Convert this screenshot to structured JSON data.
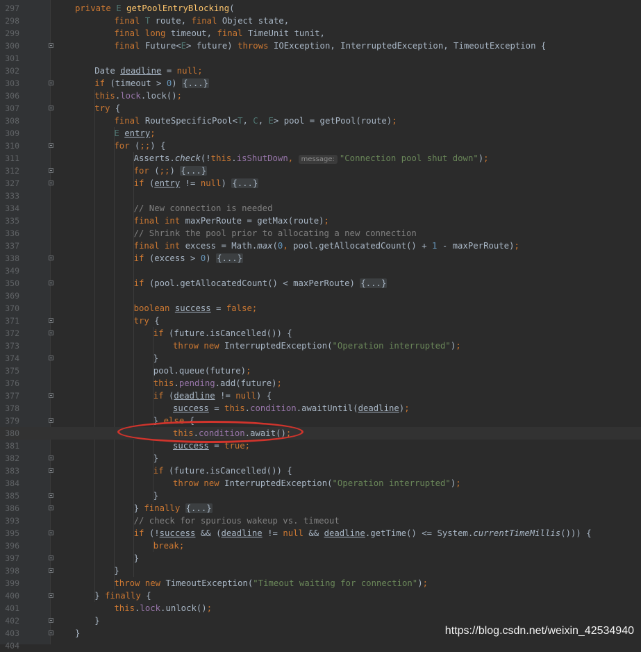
{
  "editor": {
    "lines": [
      {
        "n": "297",
        "indent": 0,
        "fold": false,
        "t": [
          [
            "kw",
            "private "
          ],
          [
            "tp",
            "E "
          ],
          [
            "fn",
            "getPoolEntryBlocking"
          ],
          [
            "",
            "("
          ]
        ]
      },
      {
        "n": "298",
        "indent": 2,
        "fold": false,
        "t": [
          [
            "kw",
            "final "
          ],
          [
            "tp",
            "T "
          ],
          [
            "",
            "route, "
          ],
          [
            "kw",
            "final "
          ],
          [
            "",
            "Object state,"
          ]
        ]
      },
      {
        "n": "299",
        "indent": 2,
        "fold": false,
        "t": [
          [
            "kw",
            "final long "
          ],
          [
            "",
            "timeout, "
          ],
          [
            "kw",
            "final "
          ],
          [
            "",
            "TimeUnit tunit,"
          ]
        ]
      },
      {
        "n": "300",
        "indent": 2,
        "fold": true,
        "t": [
          [
            "kw",
            "final "
          ],
          [
            "",
            "Future<"
          ],
          [
            "tp",
            "E"
          ],
          [
            "",
            "> future) "
          ],
          [
            "kw",
            "throws "
          ],
          [
            "",
            "IOException, InterruptedException, TimeoutException {"
          ]
        ]
      },
      {
        "n": "301",
        "indent": 0,
        "fold": false,
        "t": []
      },
      {
        "n": "302",
        "indent": 1,
        "fold": false,
        "t": [
          [
            "",
            "Date "
          ],
          [
            "ul",
            "deadline"
          ],
          [
            "",
            " = "
          ],
          [
            "kw",
            "null"
          ],
          [
            "kw",
            ";"
          ]
        ]
      },
      {
        "n": "303",
        "indent": 1,
        "fold": true,
        "t": [
          [
            "kw",
            "if "
          ],
          [
            "",
            "(timeout > "
          ],
          [
            "num",
            "0"
          ],
          [
            "",
            ") "
          ],
          [
            "ph",
            "{...}"
          ]
        ]
      },
      {
        "n": "306",
        "indent": 1,
        "fold": false,
        "t": [
          [
            "kw",
            "this"
          ],
          [
            "",
            "."
          ],
          [
            "fld",
            "lock"
          ],
          [
            "",
            ".lock()"
          ],
          [
            "kw",
            ";"
          ]
        ]
      },
      {
        "n": "307",
        "indent": 1,
        "fold": true,
        "t": [
          [
            "kw",
            "try "
          ],
          [
            "",
            "{"
          ]
        ]
      },
      {
        "n": "308",
        "indent": 2,
        "fold": false,
        "t": [
          [
            "kw",
            "final "
          ],
          [
            "",
            "RouteSpecificPool<"
          ],
          [
            "tp",
            "T"
          ],
          [
            "",
            ", "
          ],
          [
            "tp",
            "C"
          ],
          [
            "",
            ", "
          ],
          [
            "tp",
            "E"
          ],
          [
            "",
            "> pool = getPool(route)"
          ],
          [
            "kw",
            ";"
          ]
        ]
      },
      {
        "n": "309",
        "indent": 2,
        "fold": false,
        "t": [
          [
            "tp",
            "E "
          ],
          [
            "ul",
            "entry"
          ],
          [
            "kw",
            ";"
          ]
        ]
      },
      {
        "n": "310",
        "indent": 2,
        "fold": true,
        "t": [
          [
            "kw",
            "for "
          ],
          [
            "",
            "("
          ],
          [
            "kw",
            ";;"
          ],
          [
            "",
            ") {"
          ]
        ]
      },
      {
        "n": "311",
        "indent": 3,
        "fold": false,
        "t": [
          [
            "",
            "Asserts."
          ],
          [
            "st",
            "check"
          ],
          [
            "",
            "(!"
          ],
          [
            "kw",
            "this"
          ],
          [
            "",
            "."
          ],
          [
            "fld",
            "isShutDown"
          ],
          [
            "kw",
            ", "
          ],
          [
            "hint",
            "message:"
          ],
          [
            "str",
            "\"Connection pool shut down\""
          ],
          [
            "",
            ")"
          ],
          [
            "kw",
            ";"
          ]
        ]
      },
      {
        "n": "312",
        "indent": 3,
        "fold": true,
        "t": [
          [
            "kw",
            "for "
          ],
          [
            "",
            "("
          ],
          [
            "kw",
            ";;"
          ],
          [
            "",
            ") "
          ],
          [
            "ph",
            "{...}"
          ]
        ]
      },
      {
        "n": "327",
        "indent": 3,
        "fold": true,
        "t": [
          [
            "kw",
            "if "
          ],
          [
            "",
            "("
          ],
          [
            "ul",
            "entry"
          ],
          [
            "",
            " != "
          ],
          [
            "kw",
            "null"
          ],
          [
            "",
            ") "
          ],
          [
            "ph",
            "{...}"
          ]
        ]
      },
      {
        "n": "333",
        "indent": 0,
        "fold": false,
        "t": []
      },
      {
        "n": "334",
        "indent": 3,
        "fold": false,
        "t": [
          [
            "cm",
            "// New connection is needed"
          ]
        ]
      },
      {
        "n": "335",
        "indent": 3,
        "fold": false,
        "t": [
          [
            "kw",
            "final int "
          ],
          [
            "",
            "maxPerRoute = getMax(route)"
          ],
          [
            "kw",
            ";"
          ]
        ]
      },
      {
        "n": "336",
        "indent": 3,
        "fold": false,
        "t": [
          [
            "cm",
            "// Shrink the pool prior to allocating a new connection"
          ]
        ]
      },
      {
        "n": "337",
        "indent": 3,
        "fold": false,
        "t": [
          [
            "kw",
            "final int "
          ],
          [
            "",
            "excess = Math."
          ],
          [
            "st",
            "max"
          ],
          [
            "",
            "("
          ],
          [
            "num",
            "0"
          ],
          [
            "kw",
            ", "
          ],
          [
            "",
            "pool.getAllocatedCount() + "
          ],
          [
            "num",
            "1"
          ],
          [
            "",
            " - maxPerRoute)"
          ],
          [
            "kw",
            ";"
          ]
        ]
      },
      {
        "n": "338",
        "indent": 3,
        "fold": true,
        "t": [
          [
            "kw",
            "if "
          ],
          [
            "",
            "(excess > "
          ],
          [
            "num",
            "0"
          ],
          [
            "",
            ") "
          ],
          [
            "ph",
            "{...}"
          ]
        ]
      },
      {
        "n": "349",
        "indent": 0,
        "fold": false,
        "t": []
      },
      {
        "n": "350",
        "indent": 3,
        "fold": true,
        "t": [
          [
            "kw",
            "if "
          ],
          [
            "",
            "(pool.getAllocatedCount() < maxPerRoute) "
          ],
          [
            "ph",
            "{...}"
          ]
        ]
      },
      {
        "n": "369",
        "indent": 0,
        "fold": false,
        "t": []
      },
      {
        "n": "370",
        "indent": 3,
        "fold": false,
        "t": [
          [
            "kw",
            "boolean "
          ],
          [
            "ul",
            "success"
          ],
          [
            "",
            " = "
          ],
          [
            "kw",
            "false;"
          ]
        ]
      },
      {
        "n": "371",
        "indent": 3,
        "fold": true,
        "t": [
          [
            "kw",
            "try "
          ],
          [
            "",
            "{"
          ]
        ]
      },
      {
        "n": "372",
        "indent": 4,
        "fold": true,
        "t": [
          [
            "kw",
            "if "
          ],
          [
            "",
            "(future.isCancelled()) {"
          ]
        ]
      },
      {
        "n": "373",
        "indent": 5,
        "fold": false,
        "t": [
          [
            "kw",
            "throw new "
          ],
          [
            "",
            "InterruptedException("
          ],
          [
            "str",
            "\"Operation interrupted\""
          ],
          [
            "",
            ")"
          ],
          [
            "kw",
            ";"
          ]
        ]
      },
      {
        "n": "374",
        "indent": 4,
        "fold": true,
        "t": [
          [
            "",
            "}"
          ]
        ]
      },
      {
        "n": "375",
        "indent": 4,
        "fold": false,
        "t": [
          [
            "",
            "pool.queue(future)"
          ],
          [
            "kw",
            ";"
          ]
        ]
      },
      {
        "n": "376",
        "indent": 4,
        "fold": false,
        "t": [
          [
            "kw",
            "this"
          ],
          [
            "",
            "."
          ],
          [
            "fld",
            "pending"
          ],
          [
            "",
            ".add(future)"
          ],
          [
            "kw",
            ";"
          ]
        ]
      },
      {
        "n": "377",
        "indent": 4,
        "fold": true,
        "t": [
          [
            "kw",
            "if "
          ],
          [
            "",
            "("
          ],
          [
            "ul",
            "deadline"
          ],
          [
            "",
            " != "
          ],
          [
            "kw",
            "null"
          ],
          [
            "",
            ") {"
          ]
        ]
      },
      {
        "n": "378",
        "indent": 5,
        "fold": false,
        "t": [
          [
            "ul",
            "success"
          ],
          [
            "",
            " = "
          ],
          [
            "kw",
            "this"
          ],
          [
            "",
            "."
          ],
          [
            "fld",
            "condition"
          ],
          [
            "",
            ".awaitUntil("
          ],
          [
            "ul",
            "deadline"
          ],
          [
            "",
            ")"
          ],
          [
            "kw",
            ";"
          ]
        ]
      },
      {
        "n": "379",
        "indent": 4,
        "fold": true,
        "t": [
          [
            "",
            "} "
          ],
          [
            "kw",
            "else "
          ],
          [
            "",
            "{"
          ]
        ]
      },
      {
        "n": "380",
        "indent": 5,
        "fold": false,
        "current": true,
        "t": [
          [
            "kw",
            "this"
          ],
          [
            "",
            "."
          ],
          [
            "fld",
            "condition"
          ],
          [
            "",
            ".await()"
          ],
          [
            "kw",
            ";"
          ]
        ]
      },
      {
        "n": "381",
        "indent": 5,
        "fold": false,
        "t": [
          [
            "ul",
            "success"
          ],
          [
            "",
            " = "
          ],
          [
            "kw",
            "true;"
          ]
        ]
      },
      {
        "n": "382",
        "indent": 4,
        "fold": true,
        "t": [
          [
            "",
            "}"
          ]
        ]
      },
      {
        "n": "383",
        "indent": 4,
        "fold": true,
        "t": [
          [
            "kw",
            "if "
          ],
          [
            "",
            "(future.isCancelled()) {"
          ]
        ]
      },
      {
        "n": "384",
        "indent": 5,
        "fold": false,
        "t": [
          [
            "kw",
            "throw new "
          ],
          [
            "",
            "InterruptedException("
          ],
          [
            "str",
            "\"Operation interrupted\""
          ],
          [
            "",
            ")"
          ],
          [
            "kw",
            ";"
          ]
        ]
      },
      {
        "n": "385",
        "indent": 4,
        "fold": true,
        "t": [
          [
            "",
            "}"
          ]
        ]
      },
      {
        "n": "386",
        "indent": 3,
        "fold": true,
        "t": [
          [
            "",
            "} "
          ],
          [
            "kw",
            "finally "
          ],
          [
            "ph",
            "{...}"
          ]
        ]
      },
      {
        "n": "393",
        "indent": 3,
        "fold": false,
        "t": [
          [
            "cm",
            "// check for spurious wakeup vs. timeout"
          ]
        ]
      },
      {
        "n": "395",
        "indent": 3,
        "fold": true,
        "t": [
          [
            "kw",
            "if "
          ],
          [
            "",
            "(!"
          ],
          [
            "ul",
            "success"
          ],
          [
            "",
            " && ("
          ],
          [
            "ul",
            "deadline"
          ],
          [
            "",
            " != "
          ],
          [
            "kw",
            "null "
          ],
          [
            "",
            "&& "
          ],
          [
            "ul",
            "deadline"
          ],
          [
            "",
            ".getTime() <= System."
          ],
          [
            "st",
            "currentTimeMillis"
          ],
          [
            "",
            "())) {"
          ]
        ]
      },
      {
        "n": "396",
        "indent": 4,
        "fold": false,
        "t": [
          [
            "kw",
            "break;"
          ]
        ]
      },
      {
        "n": "397",
        "indent": 3,
        "fold": true,
        "t": [
          [
            "",
            "}"
          ]
        ]
      },
      {
        "n": "398",
        "indent": 2,
        "fold": true,
        "t": [
          [
            "",
            "}"
          ]
        ]
      },
      {
        "n": "399",
        "indent": 2,
        "fold": false,
        "t": [
          [
            "kw",
            "throw new "
          ],
          [
            "",
            "TimeoutException("
          ],
          [
            "str",
            "\"Timeout waiting for connection\""
          ],
          [
            "",
            ")"
          ],
          [
            "kw",
            ";"
          ]
        ]
      },
      {
        "n": "400",
        "indent": 1,
        "fold": true,
        "t": [
          [
            "",
            "} "
          ],
          [
            "kw",
            "finally "
          ],
          [
            "",
            "{"
          ]
        ]
      },
      {
        "n": "401",
        "indent": 2,
        "fold": false,
        "t": [
          [
            "kw",
            "this"
          ],
          [
            "",
            "."
          ],
          [
            "fld",
            "lock"
          ],
          [
            "",
            ".unlock()"
          ],
          [
            "kw",
            ";"
          ]
        ]
      },
      {
        "n": "402",
        "indent": 1,
        "fold": true,
        "t": [
          [
            "",
            "}"
          ]
        ]
      },
      {
        "n": "403",
        "indent": 0,
        "fold": true,
        "t": [
          [
            "",
            "}"
          ]
        ]
      },
      {
        "n": "404",
        "indent": 0,
        "fold": false,
        "t": []
      }
    ]
  },
  "watermark": {
    "text": "https://blog.csdn.net/weixin_42534940"
  },
  "colors": {
    "background": "#2b2b2b",
    "keyword": "#cc7832",
    "method": "#ffc66d",
    "string": "#6a8759",
    "number": "#6897bb",
    "field": "#9876aa",
    "comment": "#808080",
    "annotation_circle": "#d0342c"
  }
}
